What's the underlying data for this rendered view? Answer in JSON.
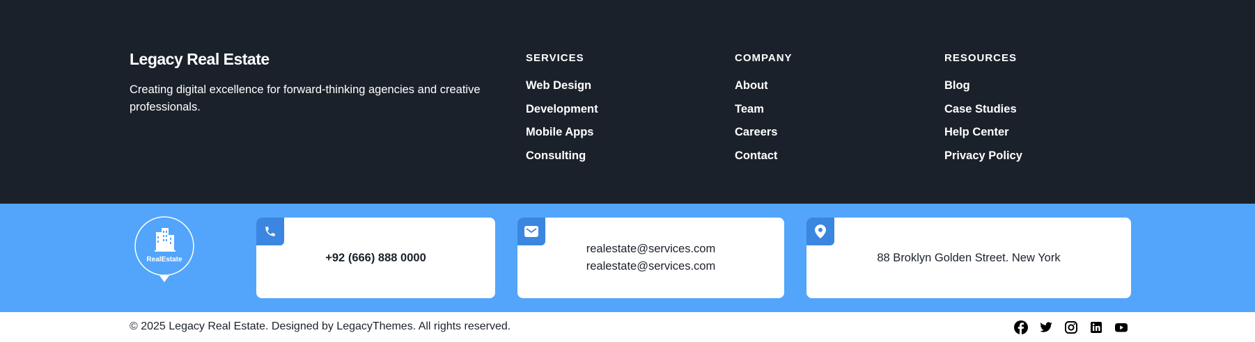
{
  "brand": {
    "name": "Legacy Real Estate",
    "tagline": "Creating digital excellence for forward-thinking agencies and creative professionals."
  },
  "columns": [
    {
      "title": "SERVICES",
      "links": [
        "Web Design",
        "Development",
        "Mobile Apps",
        "Consulting"
      ]
    },
    {
      "title": "COMPANY",
      "links": [
        "About",
        "Team",
        "Careers",
        "Contact"
      ]
    },
    {
      "title": "RESOURCES",
      "links": [
        "Blog",
        "Case Studies",
        "Help Center",
        "Privacy Policy"
      ]
    }
  ],
  "logo": {
    "text": "RealEstate"
  },
  "contact": {
    "phone": "+92 (666) 888 0000",
    "emails": [
      "realestate@services.com",
      "realestate@services.com"
    ],
    "address": "88 Broklyn Golden Street. New York"
  },
  "footer": {
    "copyright": "© 2025 Legacy Real Estate. Designed by LegacyThemes. All rights reserved."
  },
  "social": [
    "facebook-icon",
    "twitter-icon",
    "instagram-icon",
    "linkedin-icon",
    "youtube-icon"
  ],
  "colors": {
    "dark_bg": "#1b212b",
    "contact_band": "#52a5fb",
    "icon_tile": "#3a86e0",
    "text_dark": "#1b212b"
  }
}
